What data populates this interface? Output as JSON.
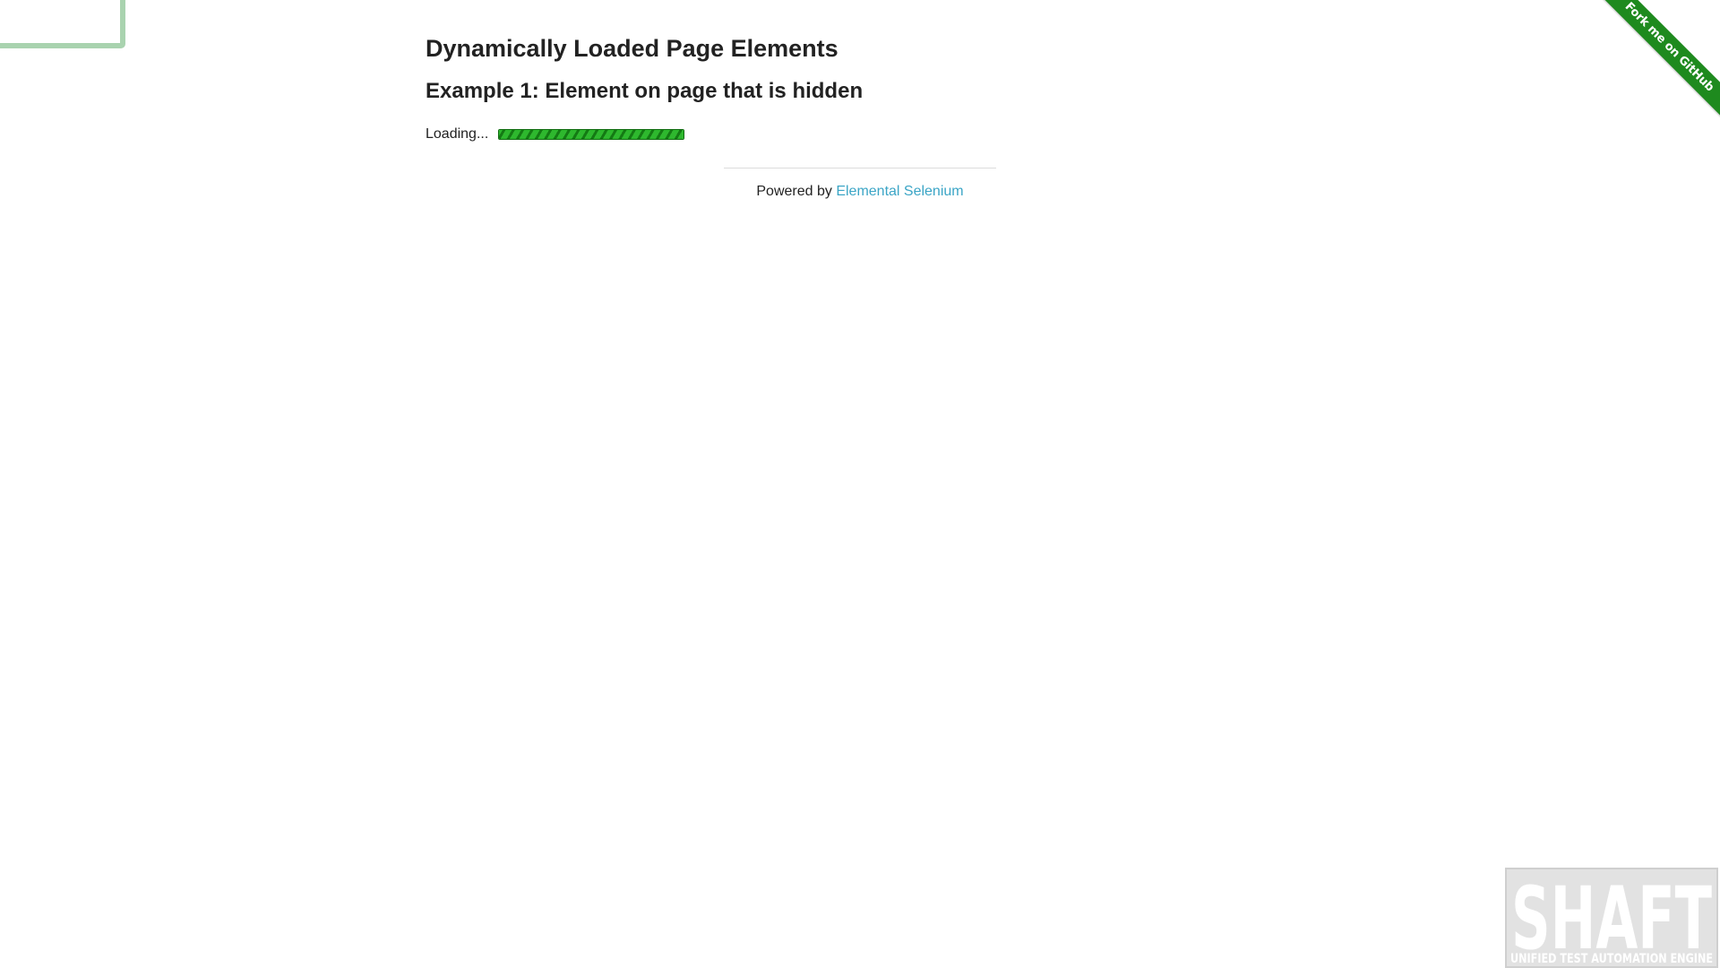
{
  "page": {
    "heading": "Dynamically Loaded Page Elements",
    "subheading": "Example 1: Element on page that is hidden"
  },
  "loading": {
    "text": "Loading...",
    "progress_percent": 100,
    "bar_color": "#2eb82e"
  },
  "footer": {
    "prefix": "Powered by ",
    "link_text": "Elemental Selenium",
    "link_color": "#3ba5c6"
  },
  "fork_ribbon": {
    "text": "Fork me on GitHub",
    "color": "#1e8a1e"
  },
  "watermark": {
    "title": "SHAFT",
    "tagline": "UNIFIED TEST AUTOMATION ENGINE"
  }
}
